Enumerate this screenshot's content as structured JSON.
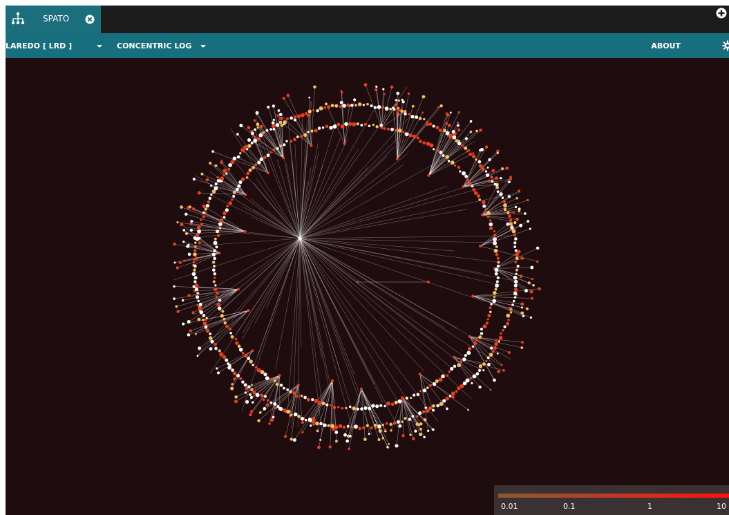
{
  "tab": {
    "label": "SPATO",
    "icon": "network-tree-icon",
    "close_icon": "close-circle-icon"
  },
  "new_tab_icon": "plus-circle-icon",
  "toolbar": {
    "network_label": "LAREDO [ LRD ]",
    "layout_label": "CONCENTRIC LOG",
    "about_label": "ABOUT",
    "settings_icon": "gear-icon"
  },
  "legend": {
    "ticks": [
      "0.01",
      "0.1",
      "1",
      "10"
    ]
  },
  "colors": {
    "background": "#1f0c0e",
    "tab_active": "#1b6e7c",
    "toolbar": "#176e7c",
    "tabbar": "#1c1c1c",
    "edges": "#ffffff",
    "node_low": "#ffffff",
    "node_mid": "#f2c060",
    "node_high": "#e8401e"
  },
  "graph": {
    "type": "concentric-network",
    "root_node": "hub",
    "rings": 2
  }
}
